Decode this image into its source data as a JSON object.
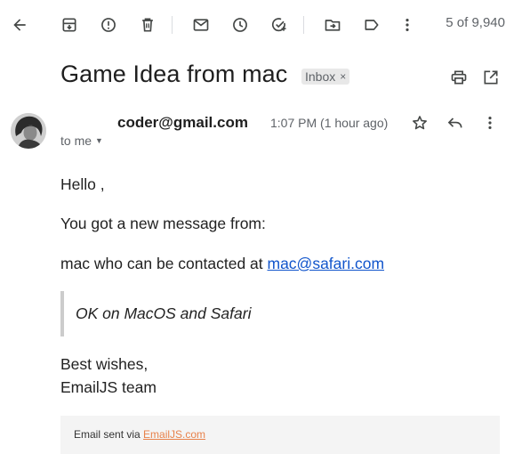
{
  "toolbar": {
    "counter": "5 of 9,940",
    "icons": [
      "back-arrow-icon",
      "archive-icon",
      "report-spam-icon",
      "delete-icon",
      "mark-unread-icon",
      "snooze-icon",
      "add-to-tasks-icon",
      "move-to-icon",
      "label-icon",
      "more-vert-icon"
    ]
  },
  "message": {
    "subject": "Game Idea from mac",
    "label": "Inbox",
    "label_close": "×",
    "sender": "coder@gmail.com",
    "time": "1:07 PM (1 hour ago)",
    "recipient": "to me",
    "recipient_caret": "▼"
  },
  "body": {
    "greeting": "Hello ,",
    "line1": "You got a new message from:",
    "contact_prefix": "mac who can be contacted at ",
    "contact_email": "mac@safari.com",
    "quote": "OK on MacOS and Safari",
    "signoff": "Best wishes,",
    "signature": "EmailJS team"
  },
  "footer": {
    "prefix": "Email sent via ",
    "link": "EmailJS.com"
  },
  "colors": {
    "link": "#1155cc",
    "footer_link": "#e8824b",
    "muted": "#5f6368",
    "quote_border": "#cccccc",
    "footer_bg": "#f4f4f4"
  }
}
